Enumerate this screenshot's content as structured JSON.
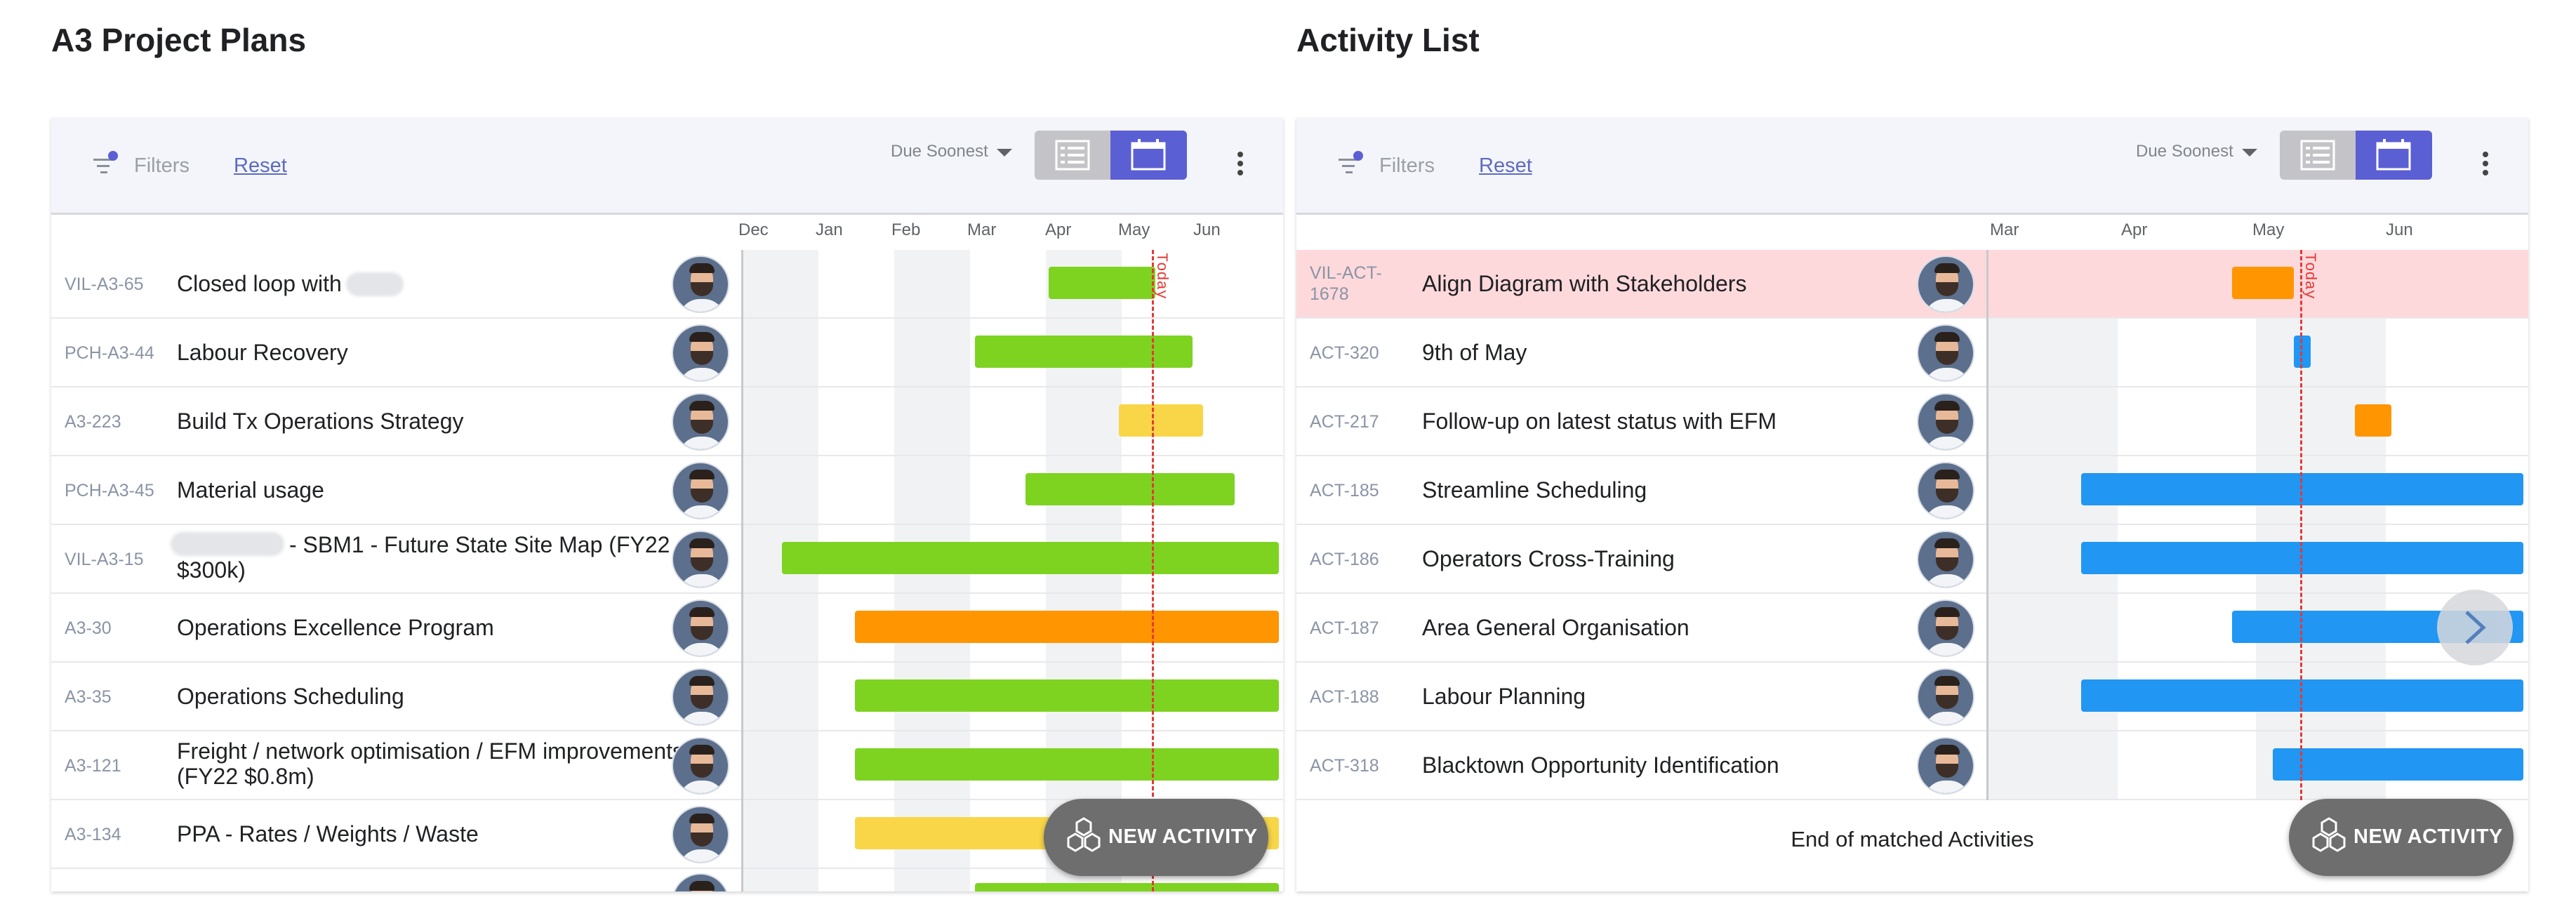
{
  "left": {
    "title": "A3 Project Plans",
    "toolbar": {
      "filters_label": "Filters",
      "reset_label": "Reset",
      "sort_label": "Due Soonest"
    },
    "months": [
      "Dec",
      "Jan",
      "Feb",
      "Mar",
      "Apr",
      "May",
      "Jun"
    ],
    "today_label": "Today",
    "rows": [
      {
        "id": "VIL-A3-65",
        "title": "Closed loop with"
      },
      {
        "id": "PCH-A3-44",
        "title": "Labour Recovery"
      },
      {
        "id": "A3-223",
        "title": "Build Tx Operations Strategy"
      },
      {
        "id": "PCH-A3-45",
        "title": "Material usage"
      },
      {
        "id": "VIL-A3-15",
        "title": "- SBM1 - Future State Site Map (FY22 $300k)"
      },
      {
        "id": "A3-30",
        "title": "Operations Excellence Program"
      },
      {
        "id": "A3-35",
        "title": "Operations Scheduling"
      },
      {
        "id": "A3-121",
        "title": "Freight / network optimisation / EFM improvements (FY22 $0.8m)"
      },
      {
        "id": "A3-134",
        "title": "PPA - Rates / Weights / Waste"
      }
    ],
    "new_activity_label": "NEW ACTIVITY"
  },
  "right": {
    "title": "Activity List",
    "toolbar": {
      "filters_label": "Filters",
      "reset_label": "Reset",
      "sort_label": "Due Soonest"
    },
    "months": [
      "Mar",
      "Apr",
      "May",
      "Jun"
    ],
    "today_label": "Today",
    "rows": [
      {
        "id": "VIL-ACT-1678",
        "title": "Align Diagram with Stakeholders"
      },
      {
        "id": "ACT-320",
        "title": "9th of May"
      },
      {
        "id": "ACT-217",
        "title": "Follow-up on latest status with EFM"
      },
      {
        "id": "ACT-185",
        "title": "Streamline Scheduling"
      },
      {
        "id": "ACT-186",
        "title": "Operators Cross-Training"
      },
      {
        "id": "ACT-187",
        "title": "Area General Organisation"
      },
      {
        "id": "ACT-188",
        "title": "Labour Planning"
      },
      {
        "id": "ACT-318",
        "title": "Blacktown Opportunity Identification"
      }
    ],
    "end_label": "End of matched Activities",
    "new_activity_label": "NEW ACTIVITY"
  },
  "colors": {
    "green": "#7ed321",
    "orange": "#ff9500",
    "yellow": "#f8d648",
    "blue": "#2196f3",
    "accent": "#5b5fd4",
    "today": "#e53935"
  },
  "icons": [
    "filter-icon",
    "list-view-icon",
    "calendar-view-icon",
    "more-vert-icon",
    "hexagon-icon",
    "chevron-right-icon"
  ]
}
